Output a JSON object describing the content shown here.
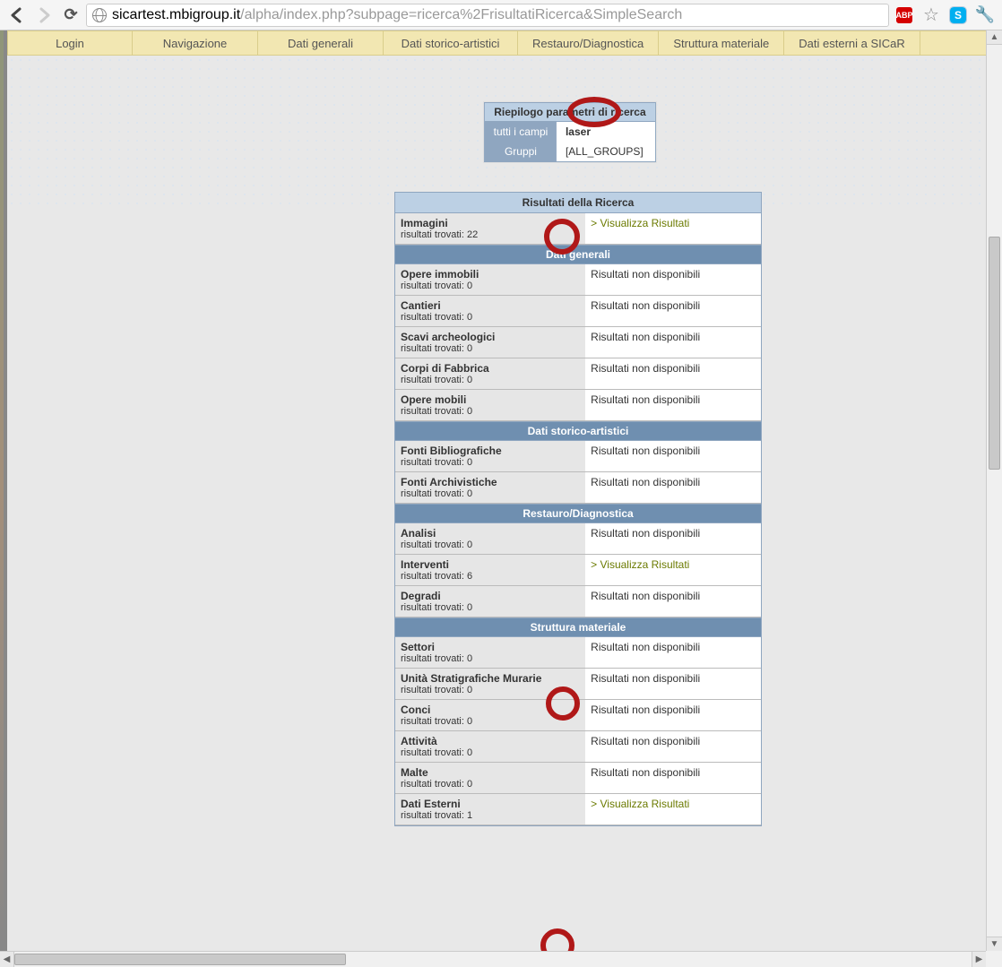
{
  "browser": {
    "url_host": "sicartest.mbigroup.it",
    "url_path": "/alpha/index.php?subpage=ricerca%2FrisultatiRicerca&SimpleSearch",
    "abp_label": "ABP",
    "skype_label": "S"
  },
  "nav": {
    "tabs": [
      "Login",
      "Navigazione",
      "Dati generali",
      "Dati storico-artistici",
      "Restauro/Diagnostica",
      "Struttura materiale",
      "Dati esterni a SICaR"
    ]
  },
  "params": {
    "title": "Riepilogo parametri di ricerca",
    "field_label": "tutti i campi",
    "field_value": "laser",
    "group_label": "Gruppi",
    "group_value": "[ALL_GROUPS]"
  },
  "results": {
    "title": "Risultati della Ricerca",
    "found_prefix": "risultati trovati: ",
    "view_label": "Visualizza Risultati",
    "na_label": "Risultati non disponibili",
    "top": {
      "name": "Immagini",
      "count": "22",
      "has_link": true
    },
    "groups": [
      {
        "title": "Dati generali",
        "rows": [
          {
            "name": "Opere immobili",
            "count": "0",
            "has_link": false
          },
          {
            "name": "Cantieri",
            "count": "0",
            "has_link": false
          },
          {
            "name": "Scavi archeologici",
            "count": "0",
            "has_link": false
          },
          {
            "name": "Corpi di Fabbrica",
            "count": "0",
            "has_link": false
          },
          {
            "name": "Opere mobili",
            "count": "0",
            "has_link": false
          }
        ]
      },
      {
        "title": "Dati storico-artistici",
        "rows": [
          {
            "name": "Fonti Bibliografiche",
            "count": "0",
            "has_link": false
          },
          {
            "name": "Fonti Archivistiche",
            "count": "0",
            "has_link": false
          }
        ]
      },
      {
        "title": "Restauro/Diagnostica",
        "rows": [
          {
            "name": "Analisi",
            "count": "0",
            "has_link": false
          },
          {
            "name": "Interventi",
            "count": "6",
            "has_link": true
          },
          {
            "name": "Degradi",
            "count": "0",
            "has_link": false
          }
        ]
      },
      {
        "title": "Struttura materiale",
        "rows": [
          {
            "name": "Settori",
            "count": "0",
            "has_link": false
          },
          {
            "name": "Unità Stratigrafiche Murarie",
            "count": "0",
            "has_link": false
          },
          {
            "name": "Conci",
            "count": "0",
            "has_link": false
          },
          {
            "name": "Attività",
            "count": "0",
            "has_link": false
          },
          {
            "name": "Malte",
            "count": "0",
            "has_link": false
          },
          {
            "name": "Dati Esterni",
            "count": "1",
            "has_link": true
          }
        ]
      }
    ]
  }
}
